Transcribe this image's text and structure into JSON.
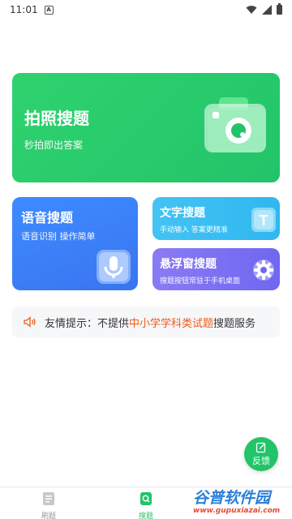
{
  "status_bar": {
    "time": "11:01",
    "notification_letter": "A"
  },
  "cards": {
    "photo": {
      "title": "拍照搜题",
      "subtitle": "秒拍即出答案"
    },
    "voice": {
      "title": "语音搜题",
      "subtitle": "语音识别 操作简单"
    },
    "text": {
      "title": "文字搜题",
      "subtitle": "手动输入 答案更精准",
      "icon_letter": "T"
    },
    "float_window": {
      "title": "悬浮窗搜题",
      "subtitle": "搜题按钮常驻于手机桌面"
    }
  },
  "notice": {
    "prefix": "友情提示：不提供",
    "highlight": "中小学学科类试题",
    "suffix": "搜题服务"
  },
  "feedback": {
    "label": "反馈"
  },
  "bottom_nav": {
    "items": [
      {
        "label": "刷题",
        "icon": "document-icon"
      },
      {
        "label": "搜题",
        "icon": "search-icon"
      }
    ]
  },
  "watermark": {
    "line1": "谷普软件园",
    "line2": "www.gupuxiazai.com"
  },
  "colors": {
    "green": "#22c46a",
    "blue": "#3a75f0",
    "cyan": "#2fb7ef",
    "purple": "#6f67f0",
    "highlight": "#f05a1a"
  }
}
